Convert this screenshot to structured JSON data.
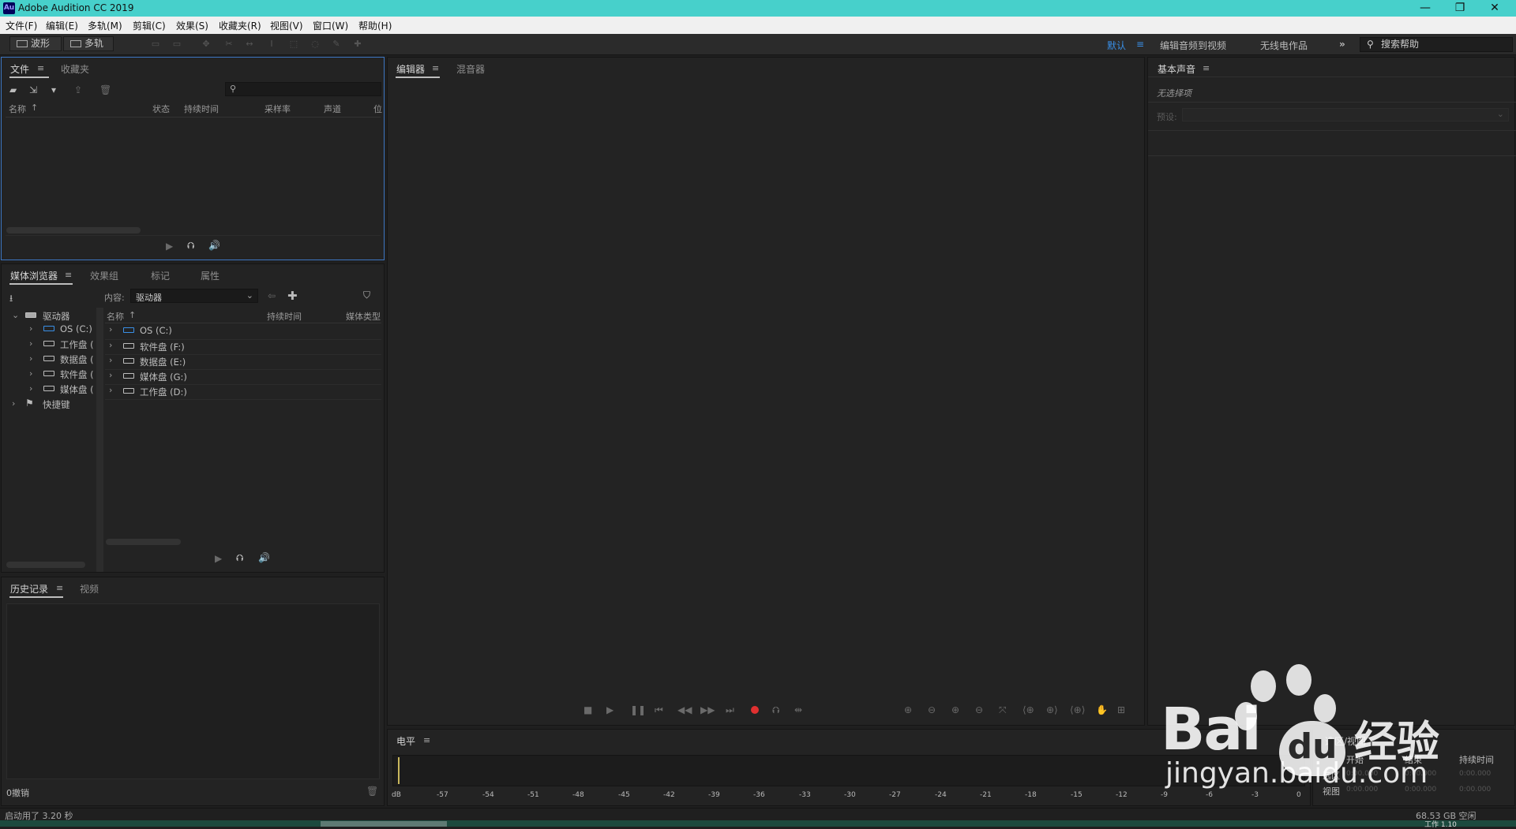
{
  "window": {
    "app_icon": "Au",
    "title": "Adobe Audition CC 2019",
    "controls": [
      "minimize-icon",
      "restore-icon",
      "close-icon"
    ]
  },
  "menu": [
    "文件(F)",
    "编辑(E)",
    "多轨(M)",
    "剪辑(C)",
    "效果(S)",
    "收藏夹(R)",
    "视图(V)",
    "窗口(W)",
    "帮助(H)"
  ],
  "toolbar": {
    "waveform_label": "波形",
    "multitrack_label": "多轨",
    "workspaces": [
      "默认",
      "编辑音频到视频",
      "无线电作品"
    ],
    "more_glyph": "»",
    "search_placeholder": "搜索帮助",
    "accent": "#3a8fe6"
  },
  "files_panel": {
    "tabs": [
      "文件",
      "收藏夹"
    ],
    "columns": [
      "名称",
      "状态",
      "持续时间",
      "采样率",
      "声道",
      "位"
    ]
  },
  "media_panel": {
    "tabs": [
      "媒体浏览器",
      "效果组",
      "标记",
      "属性"
    ],
    "content_label": "内容:",
    "content_value": "驱动器",
    "tree_root": "驱动器",
    "tree_items": [
      "OS (C:)",
      "工作盘 (",
      "数据盘 (",
      "软件盘 (",
      "媒体盘 ("
    ],
    "tree_shortcuts": "快捷键",
    "columns": [
      "名称",
      "持续时间",
      "媒体类型"
    ],
    "rows": [
      "OS (C:)",
      "软件盘 (F:)",
      "数据盘 (E:)",
      "媒体盘 (G:)",
      "工作盘 (D:)"
    ]
  },
  "history_panel": {
    "tabs": [
      "历史记录",
      "视频"
    ],
    "undo_count": "0撤销"
  },
  "editor_panel": {
    "tabs": [
      "编辑器",
      "混音器"
    ],
    "record_color": "#e03030"
  },
  "essential_panel": {
    "tab": "基本声音",
    "no_selection": "无选择项",
    "preset_label": "预设:"
  },
  "level_panel": {
    "tab": "电平",
    "scale": [
      "dB",
      "-57",
      "-54",
      "-51",
      "-48",
      "-45",
      "-42",
      "-39",
      "-36",
      "-33",
      "-30",
      "-27",
      "-24",
      "-21",
      "-18",
      "-15",
      "-12",
      "-9",
      "-6",
      "-3",
      "0"
    ]
  },
  "selection_panel": {
    "title": "选区/视图",
    "columns": [
      "开始",
      "结束",
      "持续时间"
    ],
    "row_labels": [
      "选区",
      "视图"
    ],
    "values": [
      "0:00.000",
      "0:00.000",
      "0:00.000",
      "0:00.000",
      "0:00.000",
      "0:00.000"
    ]
  },
  "status": {
    "startup": "启动用了 3.20 秒",
    "disk_free": "68.53 GB 空闲",
    "partial_bottom": "工作 1.10"
  },
  "watermark": {
    "brand_left": "Bai",
    "brand_right": "du",
    "brand_cn": "经验",
    "url": "jingyan.baidu.com"
  }
}
